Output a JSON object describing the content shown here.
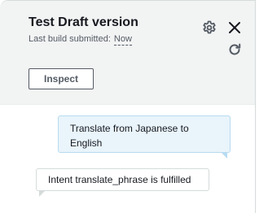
{
  "header": {
    "title": "Test Draft version",
    "subtitle_label": "Last build submitted:",
    "subtitle_value": "Now",
    "icons": [
      "gear-icon",
      "close-icon",
      "refresh-icon"
    ]
  },
  "actions": {
    "inspect_label": "Inspect"
  },
  "conversation": {
    "messages": [
      {
        "sender": "user",
        "text": "Translate from Japanese to English"
      },
      {
        "sender": "bot",
        "text": "Intent translate_phrase is fulfilled"
      }
    ]
  },
  "colors": {
    "header_bg": "#f2f3f3",
    "user_bubble_bg": "#e9f4fb",
    "user_bubble_border": "#b7dbf0",
    "bot_bubble_border": "#d5dbdb",
    "text": "#16191f",
    "muted_text": "#545b64"
  }
}
